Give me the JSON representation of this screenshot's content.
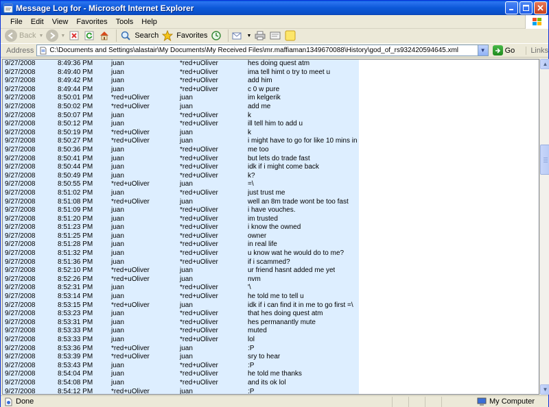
{
  "window": {
    "title": "Message Log for - Microsoft Internet Explorer"
  },
  "menu": [
    "File",
    "Edit",
    "View",
    "Favorites",
    "Tools",
    "Help"
  ],
  "toolbar": {
    "back_label": "Back",
    "search_label": "Search",
    "favorites_label": "Favorites"
  },
  "address": {
    "label": "Address",
    "value": "C:\\Documents and Settings\\alastair\\My Documents\\My Received Files\\mr.maffiaman1349670088\\History\\god_of_rs932420594645.xml",
    "go_label": "Go",
    "links_label": "Links"
  },
  "log": [
    {
      "date": "9/27/2008",
      "time": "8:49:36 PM",
      "from": "juan",
      "to": "*red+uOliver",
      "msg": "hes doing quest atm"
    },
    {
      "date": "9/27/2008",
      "time": "8:49:40 PM",
      "from": "juan",
      "to": "*red+uOliver",
      "msg": "ima tell himt o try to meet u"
    },
    {
      "date": "9/27/2008",
      "time": "8:49:42 PM",
      "from": "juan",
      "to": "*red+uOliver",
      "msg": "add him"
    },
    {
      "date": "9/27/2008",
      "time": "8:49:44 PM",
      "from": "juan",
      "to": "*red+uOliver",
      "msg": "c 0 w pure"
    },
    {
      "date": "9/27/2008",
      "time": "8:50:01 PM",
      "from": "*red+uOliver",
      "to": "juan",
      "msg": "im kelgerik"
    },
    {
      "date": "9/27/2008",
      "time": "8:50:02 PM",
      "from": "*red+uOliver",
      "to": "juan",
      "msg": "add me"
    },
    {
      "date": "9/27/2008",
      "time": "8:50:07 PM",
      "from": "juan",
      "to": "*red+uOliver",
      "msg": "k"
    },
    {
      "date": "9/27/2008",
      "time": "8:50:12 PM",
      "from": "juan",
      "to": "*red+uOliver",
      "msg": "ill tell him to add u"
    },
    {
      "date": "9/27/2008",
      "time": "8:50:19 PM",
      "from": "*red+uOliver",
      "to": "juan",
      "msg": "k"
    },
    {
      "date": "9/27/2008",
      "time": "8:50:27 PM",
      "from": "*red+uOliver",
      "to": "juan",
      "msg": "i might have to go for like 10 mins in a sec"
    },
    {
      "date": "9/27/2008",
      "time": "8:50:36 PM",
      "from": "juan",
      "to": "*red+uOliver",
      "msg": "me too"
    },
    {
      "date": "9/27/2008",
      "time": "8:50:41 PM",
      "from": "juan",
      "to": "*red+uOliver",
      "msg": "but lets do trade fast"
    },
    {
      "date": "9/27/2008",
      "time": "8:50:44 PM",
      "from": "juan",
      "to": "*red+uOliver",
      "msg": "idk if i might come back"
    },
    {
      "date": "9/27/2008",
      "time": "8:50:49 PM",
      "from": "juan",
      "to": "*red+uOliver",
      "msg": "k?"
    },
    {
      "date": "9/27/2008",
      "time": "8:50:55 PM",
      "from": "*red+uOliver",
      "to": "juan",
      "msg": "=\\"
    },
    {
      "date": "9/27/2008",
      "time": "8:51:02 PM",
      "from": "juan",
      "to": "*red+uOliver",
      "msg": "just trust me"
    },
    {
      "date": "9/27/2008",
      "time": "8:51:08 PM",
      "from": "*red+uOliver",
      "to": "juan",
      "msg": "well an 8m trade wont be too fast"
    },
    {
      "date": "9/27/2008",
      "time": "8:51:09 PM",
      "from": "juan",
      "to": "*red+uOliver",
      "msg": "i have vouches."
    },
    {
      "date": "9/27/2008",
      "time": "8:51:20 PM",
      "from": "juan",
      "to": "*red+uOliver",
      "msg": "im trusted"
    },
    {
      "date": "9/27/2008",
      "time": "8:51:23 PM",
      "from": "juan",
      "to": "*red+uOliver",
      "msg": "i know the owned"
    },
    {
      "date": "9/27/2008",
      "time": "8:51:25 PM",
      "from": "juan",
      "to": "*red+uOliver",
      "msg": "owner"
    },
    {
      "date": "9/27/2008",
      "time": "8:51:28 PM",
      "from": "juan",
      "to": "*red+uOliver",
      "msg": "in real life"
    },
    {
      "date": "9/27/2008",
      "time": "8:51:32 PM",
      "from": "juan",
      "to": "*red+uOliver",
      "msg": "u know wat he would do to me?"
    },
    {
      "date": "9/27/2008",
      "time": "8:51:36 PM",
      "from": "juan",
      "to": "*red+uOliver",
      "msg": "if i scammed?"
    },
    {
      "date": "9/27/2008",
      "time": "8:52:10 PM",
      "from": "*red+uOliver",
      "to": "juan",
      "msg": "ur friend hasnt added me yet"
    },
    {
      "date": "9/27/2008",
      "time": "8:52:26 PM",
      "from": "*red+uOliver",
      "to": "juan",
      "msg": "nvm"
    },
    {
      "date": "9/27/2008",
      "time": "8:52:31 PM",
      "from": "juan",
      "to": "*red+uOliver",
      "msg": "'\\"
    },
    {
      "date": "9/27/2008",
      "time": "8:53:14 PM",
      "from": "juan",
      "to": "*red+uOliver",
      "msg": "he told me to tell u"
    },
    {
      "date": "9/27/2008",
      "time": "8:53:15 PM",
      "from": "*red+uOliver",
      "to": "juan",
      "msg": "idk if i can find it in me to go first =\\"
    },
    {
      "date": "9/27/2008",
      "time": "8:53:23 PM",
      "from": "juan",
      "to": "*red+uOliver",
      "msg": "that hes doing quest atm"
    },
    {
      "date": "9/27/2008",
      "time": "8:53:31 PM",
      "from": "juan",
      "to": "*red+uOliver",
      "msg": "hes permanantly mute"
    },
    {
      "date": "9/27/2008",
      "time": "8:53:33 PM",
      "from": "juan",
      "to": "*red+uOliver",
      "msg": "muted"
    },
    {
      "date": "9/27/2008",
      "time": "8:53:33 PM",
      "from": "juan",
      "to": "*red+uOliver",
      "msg": "lol"
    },
    {
      "date": "9/27/2008",
      "time": "8:53:36 PM",
      "from": "*red+uOliver",
      "to": "juan",
      "msg": ":P"
    },
    {
      "date": "9/27/2008",
      "time": "8:53:39 PM",
      "from": "*red+uOliver",
      "to": "juan",
      "msg": "sry to hear"
    },
    {
      "date": "9/27/2008",
      "time": "8:53:43 PM",
      "from": "juan",
      "to": "*red+uOliver",
      "msg": ":P"
    },
    {
      "date": "9/27/2008",
      "time": "8:54:04 PM",
      "from": "juan",
      "to": "*red+uOliver",
      "msg": "he told me thanks"
    },
    {
      "date": "9/27/2008",
      "time": "8:54:08 PM",
      "from": "juan",
      "to": "*red+uOliver",
      "msg": "and its ok lol"
    },
    {
      "date": "9/27/2008",
      "time": "8:54:12 PM",
      "from": "*red+uOliver",
      "to": "juan",
      "msg": ":P"
    }
  ],
  "status": {
    "text": "Done",
    "zone": "My Computer"
  }
}
